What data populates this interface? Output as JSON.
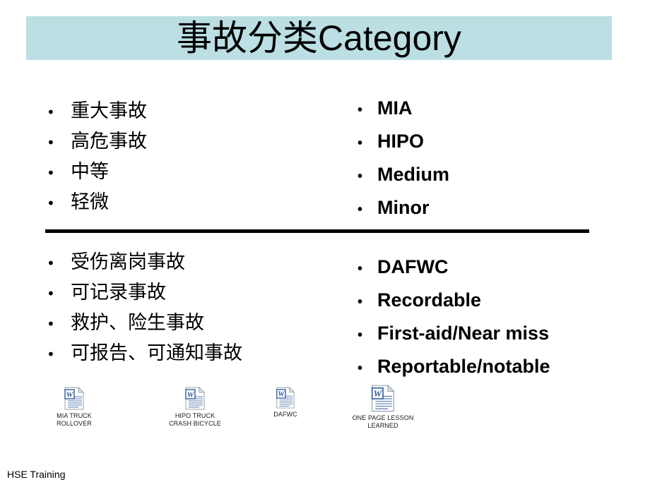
{
  "slide": {
    "title": "事故分类Category",
    "banner_color": "#bbdfe3",
    "footer": "HSE Training"
  },
  "columns": {
    "chinese_top": {
      "bullet_char": "•",
      "items": [
        "重大事故",
        "高危事故",
        "中等",
        "轻微"
      ]
    },
    "english_top": {
      "bullet_char": "•",
      "items": [
        "MIA",
        "HIPO",
        "Medium",
        "Minor"
      ]
    },
    "chinese_bottom": {
      "bullet_char": "•",
      "items": [
        "受伤离岗事故",
        "可记录事故",
        "救护、险生事故",
        "可报告、可通知事故"
      ]
    },
    "english_bottom": {
      "bullet_char": "•",
      "items": [
        "DAFWC",
        "Recordable",
        "First-aid/Near miss",
        "Reportable/notable"
      ]
    }
  },
  "attachments": {
    "icon_name": "word-document-icon",
    "items": [
      {
        "label": "MIA TRUCK\nROLLOVER"
      },
      {
        "label": "HIPO TRUCK\nCRASH BICYCLE"
      },
      {
        "label": "DAFWC"
      },
      {
        "label": "ONE PAGE LESSON\nLEARNED"
      }
    ]
  }
}
